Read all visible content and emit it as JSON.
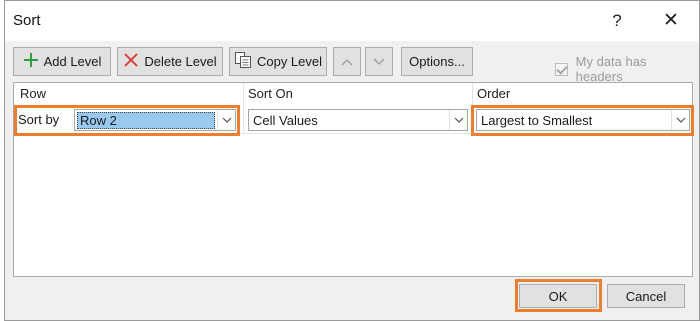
{
  "window": {
    "title": "Sort",
    "help_glyph": "?",
    "close_glyph": "✕"
  },
  "toolbar": {
    "add_level_label": "Add Level",
    "delete_level_label": "Delete Level",
    "copy_level_label": "Copy Level",
    "move_up_glyph": "︿",
    "move_down_glyph": "﹀",
    "options_label": "Options...",
    "my_data_has_headers_label": "My data has headers",
    "my_data_has_headers_checked": true,
    "my_data_has_headers_enabled": false
  },
  "columns": {
    "row": "Row",
    "sort_on": "Sort On",
    "order": "Order"
  },
  "level": {
    "sort_by_label": "Sort by",
    "row_value": "Row 2",
    "sort_on_value": "Cell Values",
    "order_value": "Largest to Smallest"
  },
  "footer": {
    "ok_label": "OK",
    "cancel_label": "Cancel"
  },
  "colors": {
    "highlight": "#ed7d31",
    "selection": "#99c9ef",
    "add_icon": "#2e9e3e",
    "delete_icon": "#d9453a"
  },
  "icons": {
    "add": "plus-icon",
    "delete": "x-icon",
    "copy": "copy-icon",
    "dropdown": "chevron-down-icon"
  }
}
